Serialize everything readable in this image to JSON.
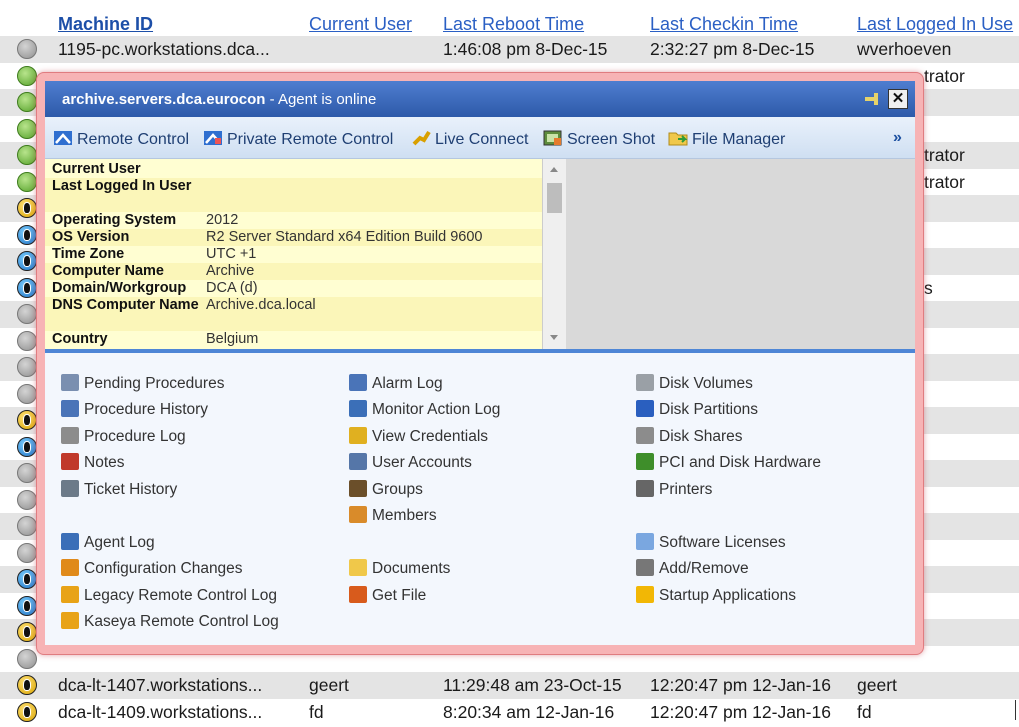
{
  "table": {
    "headers": [
      "Machine ID",
      "Current User",
      "Last Reboot Time",
      "Last Checkin Time",
      "Last Logged In Use"
    ],
    "rows": [
      {
        "status": "gray",
        "machine": "1195-pc.workstations.dca...",
        "user": "",
        "reboot": "1:46:08 pm 8-Dec-15",
        "checkin": "2:32:27 pm 8-Dec-15",
        "last_user": "wverhoeven"
      },
      {
        "status": "green",
        "machine": "",
        "user": "",
        "reboot": "",
        "checkin": "",
        "last_user": "trator"
      },
      {
        "status": "green",
        "machine": "",
        "user": "",
        "reboot": "",
        "checkin": "",
        "last_user": ""
      },
      {
        "status": "green",
        "machine": "",
        "user": "",
        "reboot": "",
        "checkin": "",
        "last_user": ""
      },
      {
        "status": "green",
        "machine": "",
        "user": "",
        "reboot": "",
        "checkin": "",
        "last_user": "trator"
      },
      {
        "status": "green",
        "machine": "",
        "user": "",
        "reboot": "",
        "checkin": "",
        "last_user": "trator"
      },
      {
        "status": "agent",
        "machine": "",
        "user": "",
        "reboot": "",
        "checkin": "",
        "last_user": ""
      },
      {
        "status": "agent-blue",
        "machine": "",
        "user": "",
        "reboot": "",
        "checkin": "",
        "last_user": ""
      },
      {
        "status": "agent-blue",
        "machine": "",
        "user": "",
        "reboot": "",
        "checkin": "",
        "last_user": ""
      },
      {
        "status": "agent-blue",
        "machine": "",
        "user": "",
        "reboot": "",
        "checkin": "",
        "last_user": "s"
      },
      {
        "status": "gray",
        "machine": "",
        "user": "",
        "reboot": "",
        "checkin": "",
        "last_user": ""
      },
      {
        "status": "gray",
        "machine": "",
        "user": "",
        "reboot": "",
        "checkin": "",
        "last_user": ""
      },
      {
        "status": "gray",
        "machine": "",
        "user": "",
        "reboot": "",
        "checkin": "",
        "last_user": ""
      },
      {
        "status": "gray",
        "machine": "",
        "user": "",
        "reboot": "",
        "checkin": "",
        "last_user": ""
      },
      {
        "status": "agent",
        "machine": "",
        "user": "",
        "reboot": "",
        "checkin": "",
        "last_user": ""
      },
      {
        "status": "agent-blue",
        "machine": "",
        "user": "",
        "reboot": "",
        "checkin": "",
        "last_user": ""
      },
      {
        "status": "gray",
        "machine": "",
        "user": "",
        "reboot": "",
        "checkin": "",
        "last_user": ""
      },
      {
        "status": "gray",
        "machine": "",
        "user": "",
        "reboot": "",
        "checkin": "",
        "last_user": ""
      },
      {
        "status": "gray",
        "machine": "",
        "user": "",
        "reboot": "",
        "checkin": "",
        "last_user": ""
      },
      {
        "status": "gray",
        "machine": "",
        "user": "",
        "reboot": "",
        "checkin": "",
        "last_user": ""
      },
      {
        "status": "agent-blue",
        "machine": "",
        "user": "",
        "reboot": "",
        "checkin": "",
        "last_user": ""
      },
      {
        "status": "agent-blue",
        "machine": "",
        "user": "",
        "reboot": "",
        "checkin": "",
        "last_user": ""
      },
      {
        "status": "agent",
        "machine": "",
        "user": "",
        "reboot": "",
        "checkin": "",
        "last_user": ""
      },
      {
        "status": "gray",
        "machine": "",
        "user": "",
        "reboot": "",
        "checkin": "",
        "last_user": ""
      },
      {
        "status": "agent",
        "machine": "dca-lt-1407.workstations...",
        "user": "geert",
        "reboot": "11:29:48 am 23-Oct-15",
        "checkin": "12:20:47 pm 12-Jan-16",
        "last_user": "geert"
      },
      {
        "status": "agent",
        "machine": "dca-lt-1409.workstations...",
        "user": "fd",
        "reboot": "8:20:34 am 12-Jan-16",
        "checkin": "12:20:47 pm 12-Jan-16",
        "last_user": "fd"
      }
    ]
  },
  "popup": {
    "machine_name": "archive.servers.dca.eurocon",
    "status_text": " - Agent is online",
    "close_label": "✕",
    "more_label": "»",
    "toolbar": [
      {
        "label": "Remote Control",
        "icon": "remote-control-icon"
      },
      {
        "label": "Private Remote Control",
        "icon": "private-remote-control-icon"
      },
      {
        "label": "Live Connect",
        "icon": "live-connect-icon"
      },
      {
        "label": "Screen Shot",
        "icon": "screenshot-icon"
      },
      {
        "label": "File Manager",
        "icon": "file-manager-icon"
      }
    ],
    "info": [
      {
        "key": "Current User",
        "value": ""
      },
      {
        "key": "Last Logged In User",
        "value": ""
      },
      {
        "key": "Operating System",
        "value": "2012"
      },
      {
        "key": "OS Version",
        "value": "R2 Server Standard x64 Edition Build 9600"
      },
      {
        "key": "Time Zone",
        "value": "UTC +1"
      },
      {
        "key": "Computer Name",
        "value": "Archive"
      },
      {
        "key": "Domain/Workgroup",
        "value": "DCA (d)"
      },
      {
        "key": "DNS Computer Name",
        "value": "Archive.dca.local"
      },
      {
        "key": "Country",
        "value": "Belgium"
      }
    ],
    "links": {
      "col1": [
        {
          "label": "Pending Procedures",
          "icon": "pending-procedures-icon"
        },
        {
          "label": "Procedure History",
          "icon": "procedure-history-icon"
        },
        {
          "label": "Procedure Log",
          "icon": "procedure-log-icon"
        },
        {
          "label": "Notes",
          "icon": "notes-icon"
        },
        {
          "label": "Ticket History",
          "icon": "ticket-history-icon"
        },
        {
          "label": "Agent Log",
          "icon": "agent-log-icon"
        },
        {
          "label": "Configuration Changes",
          "icon": "configuration-changes-icon"
        },
        {
          "label": "Legacy Remote Control Log",
          "icon": "legacy-remote-control-log-icon"
        },
        {
          "label": "Kaseya Remote Control Log",
          "icon": "kaseya-remote-control-log-icon"
        }
      ],
      "col2": [
        {
          "label": "Alarm Log",
          "icon": "alarm-log-icon"
        },
        {
          "label": "Monitor Action Log",
          "icon": "monitor-action-log-icon"
        },
        {
          "label": "View Credentials",
          "icon": "key-icon"
        },
        {
          "label": "User Accounts",
          "icon": "user-accounts-icon"
        },
        {
          "label": "Groups",
          "icon": "groups-icon"
        },
        {
          "label": "Members",
          "icon": "members-icon"
        },
        {
          "label": "Documents",
          "icon": "folder-icon"
        },
        {
          "label": "Get File",
          "icon": "get-file-icon"
        }
      ],
      "col3": [
        {
          "label": "Disk Volumes",
          "icon": "disk-volumes-icon"
        },
        {
          "label": "Disk Partitions",
          "icon": "disk-partitions-icon"
        },
        {
          "label": "Disk Shares",
          "icon": "disk-shares-icon"
        },
        {
          "label": "PCI and Disk Hardware",
          "icon": "pci-hardware-icon"
        },
        {
          "label": "Printers",
          "icon": "printer-icon"
        },
        {
          "label": "Software Licenses",
          "icon": "software-licenses-icon"
        },
        {
          "label": "Add/Remove",
          "icon": "add-remove-icon"
        },
        {
          "label": "Startup Applications",
          "icon": "startup-applications-icon"
        }
      ]
    }
  }
}
